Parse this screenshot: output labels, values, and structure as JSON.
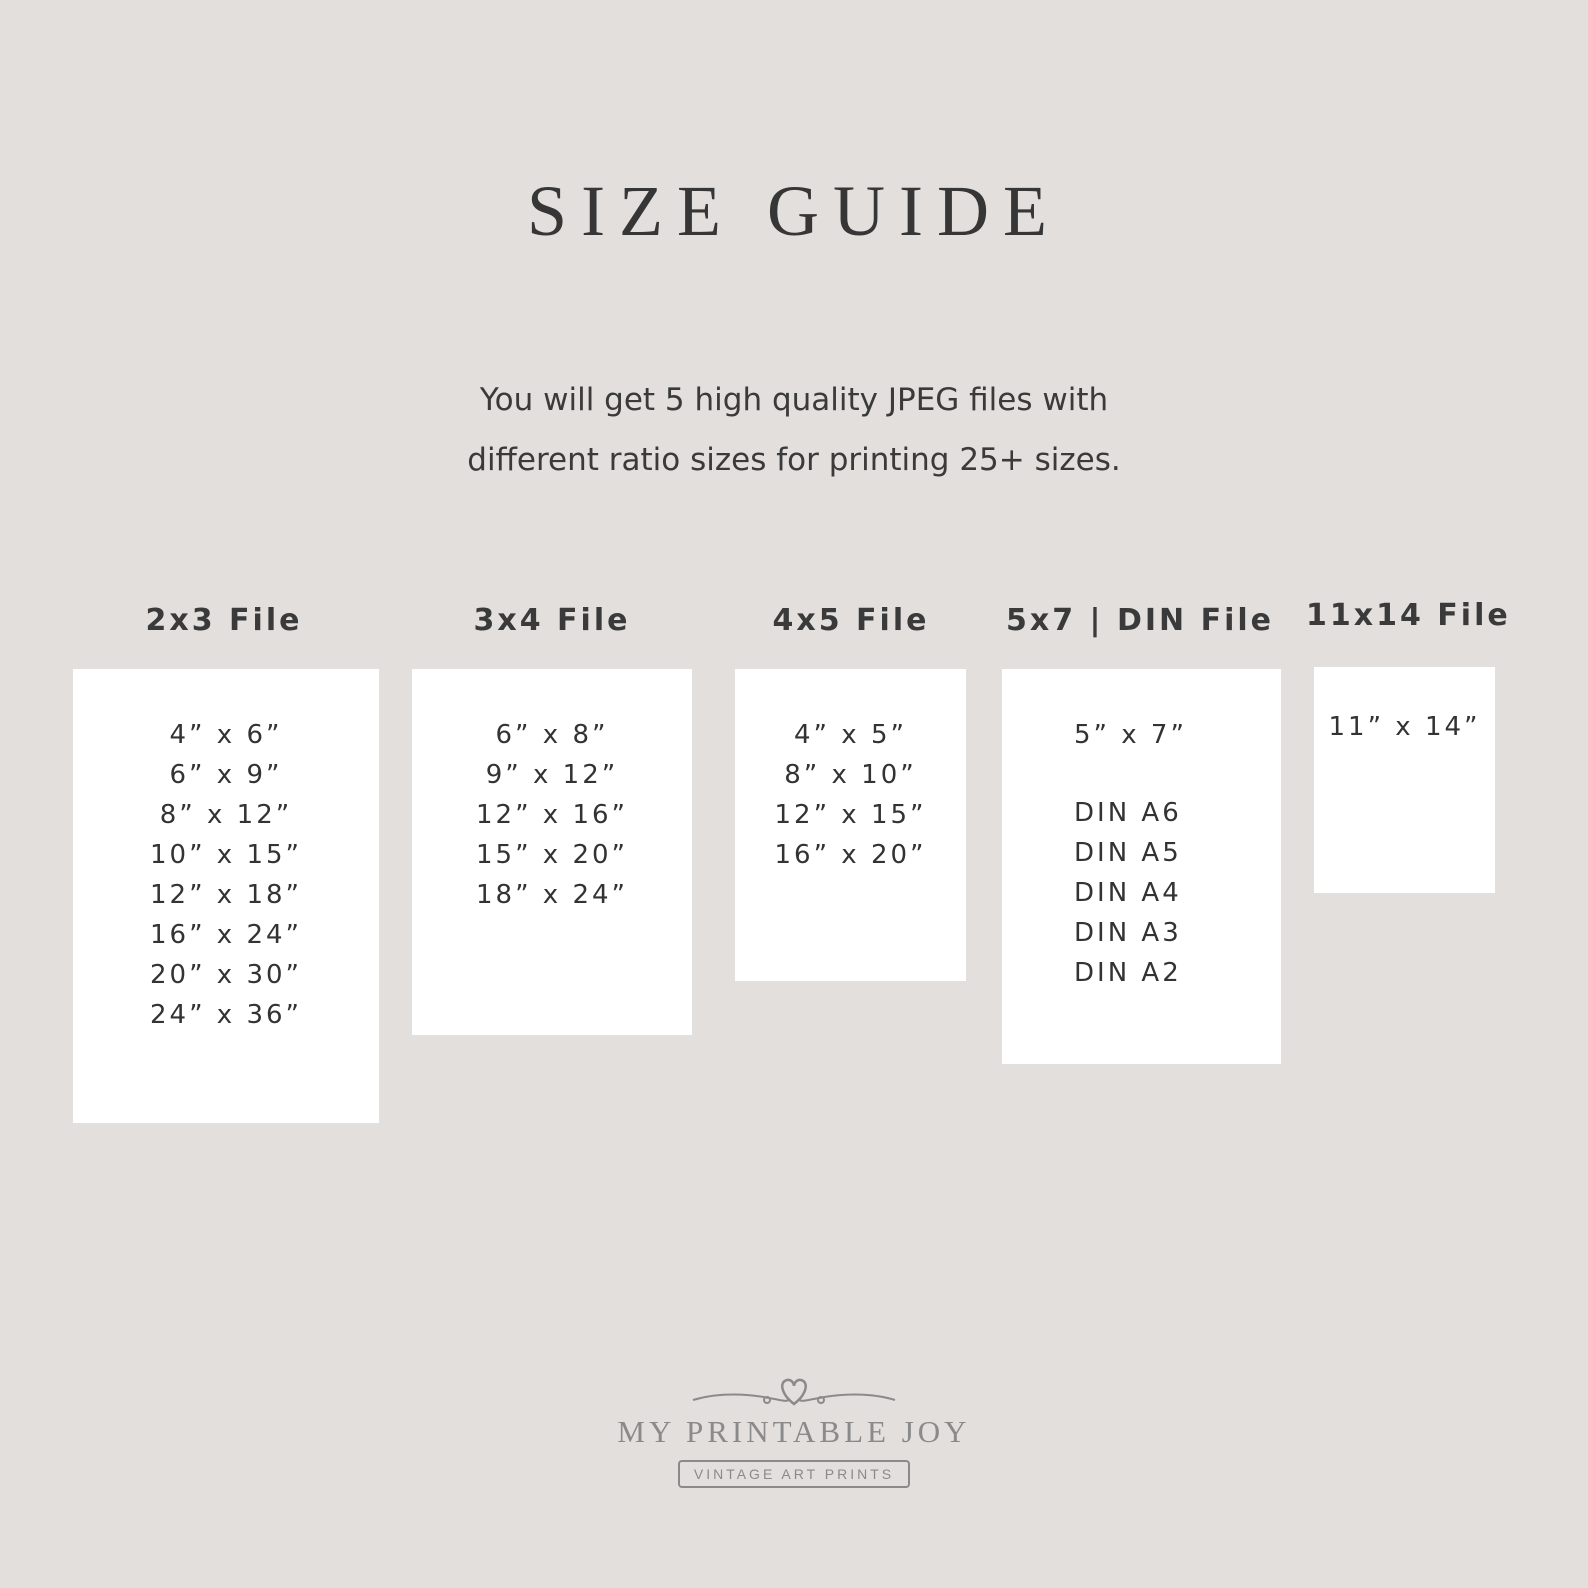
{
  "title": "SIZE GUIDE",
  "subtitle": {
    "line1": "You will get 5 high quality JPEG files with",
    "line2": "different ratio sizes for printing 25+ sizes."
  },
  "files": [
    {
      "label": "2x3 File",
      "sizes": [
        "4” x 6”",
        "6” x 9”",
        "8” x 12”",
        "10” x 15”",
        "12” x 18”",
        "16” x 24”",
        "20” x 30”",
        "24” x 36”"
      ]
    },
    {
      "label": "3x4 File",
      "sizes": [
        "6” x 8”",
        "9” x 12”",
        "12” x 16”",
        "15” x 20”",
        "18” x 24”"
      ]
    },
    {
      "label": "4x5 File",
      "sizes": [
        "4” x 5”",
        "8” x 10”",
        "12” x 15”",
        "16” x 20”"
      ]
    },
    {
      "label": "5x7 | DIN File",
      "sizes": [
        "5” x 7”"
      ],
      "din_sizes": [
        "DIN A6",
        "DIN A5",
        "DIN A4",
        "DIN A3",
        "DIN A2"
      ]
    },
    {
      "label": "11x14 File",
      "sizes": [
        "11” x 14”"
      ]
    }
  ],
  "brand": {
    "name": "MY PRINTABLE JOY",
    "tagline": "VINTAGE ART PRINTS"
  },
  "colors": {
    "background": "#e2dfdc",
    "card": "#ffffff",
    "text": "#3a3a3a",
    "brand": "#8a8a8a"
  },
  "icons": {
    "logo_ornament": "heart-flourish-icon"
  }
}
